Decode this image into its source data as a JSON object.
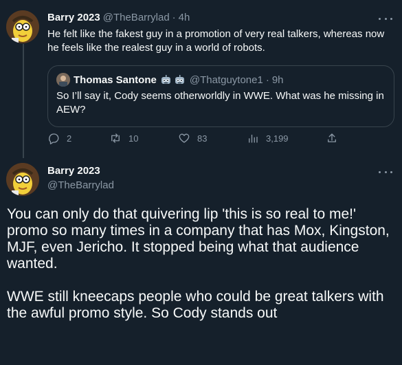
{
  "main_tweet": {
    "author_name": "Barry 2023",
    "author_handle": "@TheBarrylad",
    "separator": "·",
    "time": "4h",
    "text": "He felt like the fakest guy in a promotion of very real talkers, whereas now he feels like the realest guy in a world of robots."
  },
  "quoted_tweet": {
    "author_name": "Thomas Santone",
    "author_handle": "@Thatguytone1",
    "separator": "·",
    "time": "9h",
    "text": "So I’ll say it, Cody seems otherworldly in WWE. What was he missing in AEW?",
    "badge_icons": [
      "robot-emoji",
      "robot-emoji"
    ]
  },
  "actions": {
    "replies": "2",
    "retweets": "10",
    "likes": "83",
    "views": "3,199"
  },
  "reply_tweet": {
    "author_name": "Barry 2023",
    "author_handle": "@TheBarrylad",
    "paragraph1": "You can only do that quivering lip 'this is so real to me!' promo so many times in a company that has Mox, Kingston, MJF, even Jericho. It stopped being what that audience wanted.",
    "paragraph2": "WWE still kneecaps people who could be great talkers with the awful promo style. So Cody stands out"
  },
  "colors": {
    "background": "#15202b",
    "text": "#f7f9f9",
    "secondary_text": "#8b98a5",
    "border": "#38444d"
  }
}
